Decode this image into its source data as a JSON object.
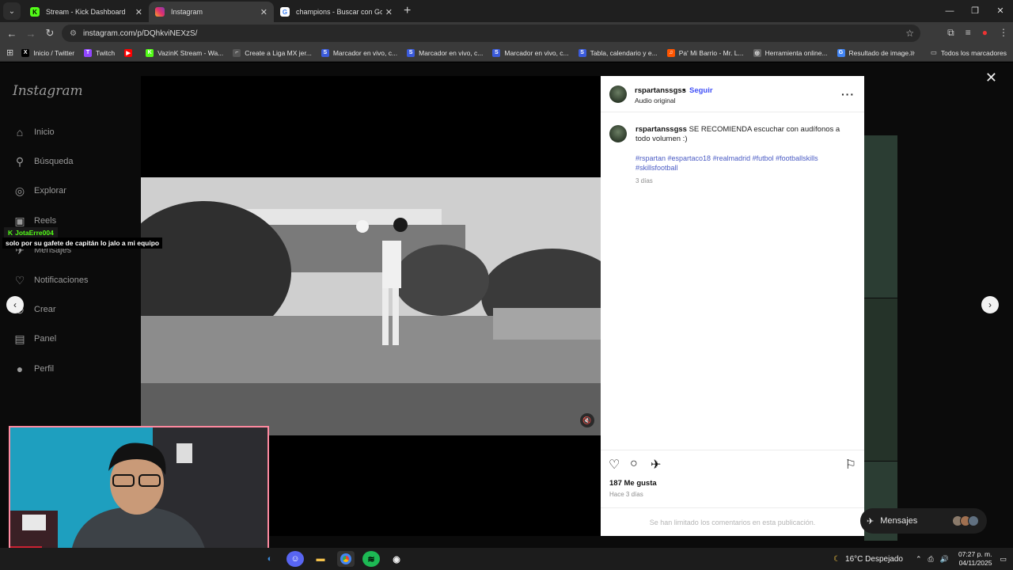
{
  "browser": {
    "tabs": [
      {
        "title": "Stream - Kick Dashboard",
        "icon": "kick-icon",
        "color": "#53fc18",
        "glyph": "K",
        "active": false
      },
      {
        "title": "Instagram",
        "icon": "instagram-icon",
        "color": "#e1306c",
        "glyph": "",
        "active": true
      },
      {
        "title": "champions - Buscar con Google",
        "icon": "google-icon",
        "color": "#4285f4",
        "glyph": "G",
        "active": false
      }
    ],
    "new_tab": "+",
    "url": "instagram.com/p/DQhkviNEXzS/",
    "bookmarks": [
      {
        "label": "Inicio / Twitter",
        "color": "#000000",
        "glyph": "X"
      },
      {
        "label": "Twitch",
        "color": "#9146ff",
        "glyph": "T"
      },
      {
        "label": "",
        "color": "#ff0000",
        "glyph": "▶"
      },
      {
        "label": "VazinK Stream - Wa...",
        "color": "#53fc18",
        "glyph": "K"
      },
      {
        "label": "Create a Liga MX jer...",
        "color": "#555555",
        "glyph": "⌐"
      },
      {
        "label": "Marcador en vivo, c...",
        "color": "#3b5bdb",
        "glyph": "S"
      },
      {
        "label": "Marcador en vivo, c...",
        "color": "#3b5bdb",
        "glyph": "S"
      },
      {
        "label": "Marcador en vivo, c...",
        "color": "#3b5bdb",
        "glyph": "S"
      },
      {
        "label": "Tabla, calendario y e...",
        "color": "#3b5bdb",
        "glyph": "S"
      },
      {
        "label": "Pa' Mi Barrio - Mr. L...",
        "color": "#ff5500",
        "glyph": "♫"
      },
      {
        "label": "Herramienta online...",
        "color": "#666666",
        "glyph": "◎"
      },
      {
        "label": "Resultado de image...",
        "color": "#4285f4",
        "glyph": "G"
      }
    ],
    "all_bookmarks": "Todos los marcadores"
  },
  "instagram": {
    "logo": "Instagram",
    "nav": [
      {
        "label": "Inicio",
        "icon": "home-icon",
        "glyph": "⌂"
      },
      {
        "label": "Búsqueda",
        "icon": "search-icon",
        "glyph": "⚲"
      },
      {
        "label": "Explorar",
        "icon": "compass-icon",
        "glyph": "◎"
      },
      {
        "label": "Reels",
        "icon": "reels-icon",
        "glyph": "▣"
      },
      {
        "label": "Mensajes",
        "icon": "messages-icon",
        "glyph": "✈"
      },
      {
        "label": "Notificaciones",
        "icon": "heart-icon",
        "glyph": "♡"
      },
      {
        "label": "Crear",
        "icon": "plus-icon",
        "glyph": "⊕"
      },
      {
        "label": "Panel",
        "icon": "panel-icon",
        "glyph": "▤"
      },
      {
        "label": "Perfil",
        "icon": "profile-icon",
        "glyph": "●"
      }
    ],
    "post": {
      "username": "rspartanssgss",
      "dot": "•",
      "follow": "Seguir",
      "audio": "Audio original",
      "caption_user": "rspartanssgss",
      "caption_text": " SE RECOMIENDA escuchar con audífonos a todo volumen :)",
      "hashtags": "#rspartan #espartaco18 #realmadrid #futbol #footballskills #skillsfootball",
      "age": "3 días",
      "likes": "187 Me gusta",
      "when": "Hace 3 días",
      "comments_limited": "Se han limitado los comentarios en esta publicación."
    },
    "messages": "Mensajes"
  },
  "stream_overlay": {
    "chat_user": "JotaErre004",
    "chat_message": "solo por su gafete de capitán lo jalo a mi equipo"
  },
  "taskbar": {
    "weather": "16°C  Despejado",
    "time": "07:27 p. m.",
    "date": "04/11/2025"
  }
}
